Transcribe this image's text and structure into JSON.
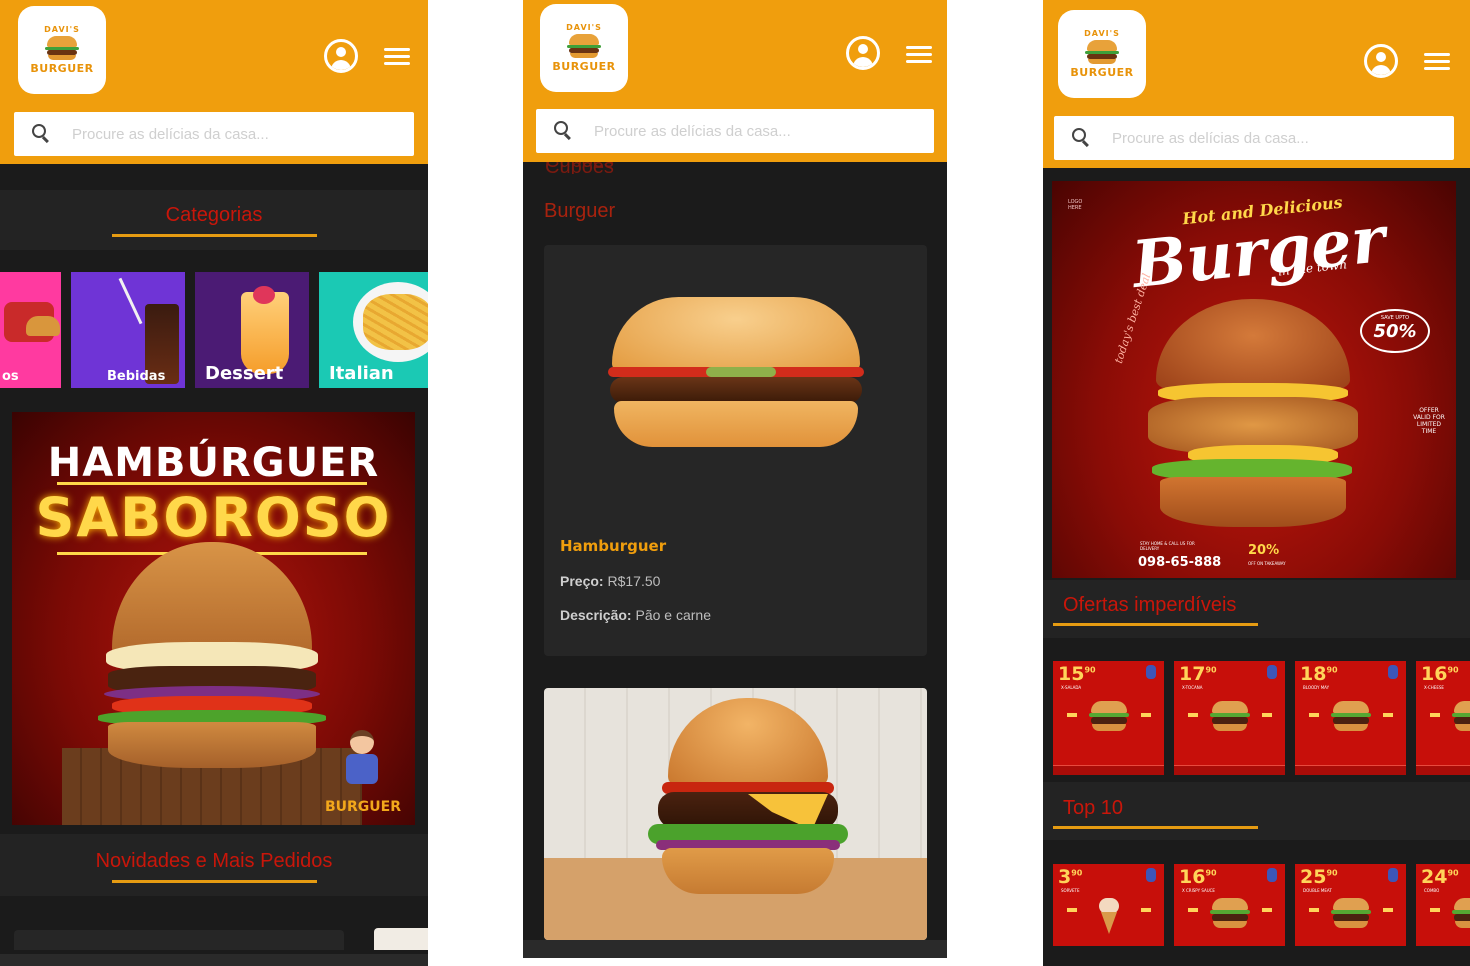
{
  "brand": {
    "logo_top": "DAVI'S",
    "logo_text": "BURGUER",
    "promo_brand": "BURGUER"
  },
  "search": {
    "placeholder": "Procure as delícias da casa..."
  },
  "colors": {
    "header": "#f09e0d",
    "title_red": "#c9160a",
    "accent": "#e59b12",
    "bg": "#1b1b1b"
  },
  "icons": {
    "user": "user-circle-icon",
    "menu": "hamburger-menu-icon",
    "search": "search-icon"
  },
  "screen1": {
    "categories_title": "Categorias",
    "categories": [
      {
        "label": "os",
        "color": "#ff3aa0"
      },
      {
        "label": "Bebidas",
        "color": "#6f34d6"
      },
      {
        "label": "Dessert",
        "color": "#4b1b74"
      },
      {
        "label": "Italian",
        "color": "#1bc9b4"
      }
    ],
    "promo": {
      "line1": "HAMBÚRGUER",
      "line2": "SABOROSO"
    },
    "news_title": "Novidades e Mais Pedidos"
  },
  "screen2": {
    "partial_title": "Cupões",
    "section_title": "Burguer",
    "product": {
      "name": "Hamburguer",
      "price_label": "Preço:",
      "price": "R$17.50",
      "desc_label": "Descrição:",
      "desc": "Pão e carne"
    }
  },
  "screen3": {
    "promo": {
      "hot": "Hot and Delicious",
      "big": "Burger",
      "sub": "in the town",
      "save": "SAVE UPTO",
      "save_pct": "50%",
      "tagline": "today's best deal",
      "phone": "098-65-888",
      "phone_note": "STAY HOME & CALL US FOR DELIVERY",
      "small_pct": "20%",
      "small_note": "OFF ON TAKEAWAY",
      "offer_note": "OFFER VALID FOR LIMITED TIME",
      "logo_here": "LOGO HERE"
    },
    "offers_title": "Ofertas imperdíveis",
    "offers": [
      {
        "price": "15",
        "cents": "90",
        "name": "X-SALADA"
      },
      {
        "price": "17",
        "cents": "90",
        "name": "X-TOCANA"
      },
      {
        "price": "18",
        "cents": "90",
        "name": "BLOODY MAY"
      },
      {
        "price": "16",
        "cents": "90",
        "name": "X-CHEESE"
      }
    ],
    "top_title": "Top 10",
    "top": [
      {
        "price": "3",
        "cents": "90",
        "name": "SORVETE"
      },
      {
        "price": "16",
        "cents": "90",
        "name": "X CRISPY SAUCE"
      },
      {
        "price": "25",
        "cents": "90",
        "name": "DOUBLE MEAT"
      },
      {
        "price": "24",
        "cents": "90",
        "name": "COMBO"
      }
    ]
  }
}
